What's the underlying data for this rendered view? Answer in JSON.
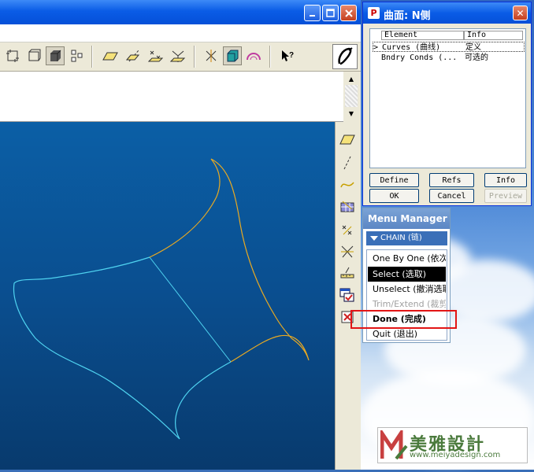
{
  "colors": {
    "title_blue": "#0a5ce6",
    "viewport_blue": "#0a4e8f",
    "curve_cyan": "#4fd3f0",
    "curve_orange": "#e8a922",
    "highlight_red": "#e21515"
  },
  "main_window": {
    "title_buttons": [
      "minimize",
      "maximize",
      "close"
    ]
  },
  "toolbar": {
    "icons": [
      "view-box-icon",
      "view-box-2-icon",
      "shaded-cube-icon",
      "model-tree-icon",
      "datum-plane-icon",
      "datum-axis-icon",
      "datum-point-icon",
      "coord-sys-icon",
      "spin-center-icon",
      "orient-cube-icon",
      "render-icon",
      "whats-this-icon"
    ],
    "big_icon": "sketch-pen-icon"
  },
  "dialog": {
    "title": "曲面: N侧",
    "icon_glyph": "P",
    "close_glyph": "✕",
    "columns": [
      "Element",
      "Info"
    ],
    "rows": [
      {
        "marker": ">",
        "element": "Curves (曲线)",
        "info": "定义"
      },
      {
        "marker": "",
        "element": "Bndry Conds (...",
        "info": "可选的"
      }
    ],
    "buttons": {
      "define": "Define",
      "refs": "Refs",
      "info": "Info",
      "ok": "OK",
      "cancel": "Cancel",
      "preview": "Preview"
    }
  },
  "menu_manager": {
    "title": "Menu Manager",
    "submenu": "CHAIN (链)",
    "items": [
      {
        "label": "One By One (依次)",
        "state": "normal"
      },
      {
        "label": "Select (选取)",
        "state": "highlighted"
      },
      {
        "label": "Unselect (撤消选取)",
        "state": "normal"
      },
      {
        "label": "Trim/Extend (裁剪/延伸)",
        "state": "disabled"
      },
      {
        "label": "Done (完成)",
        "state": "bold"
      },
      {
        "label": "Quit (退出)",
        "state": "normal"
      }
    ]
  },
  "watermark": {
    "brand": "美雅設計",
    "url": "www.meiyadesign.com"
  }
}
